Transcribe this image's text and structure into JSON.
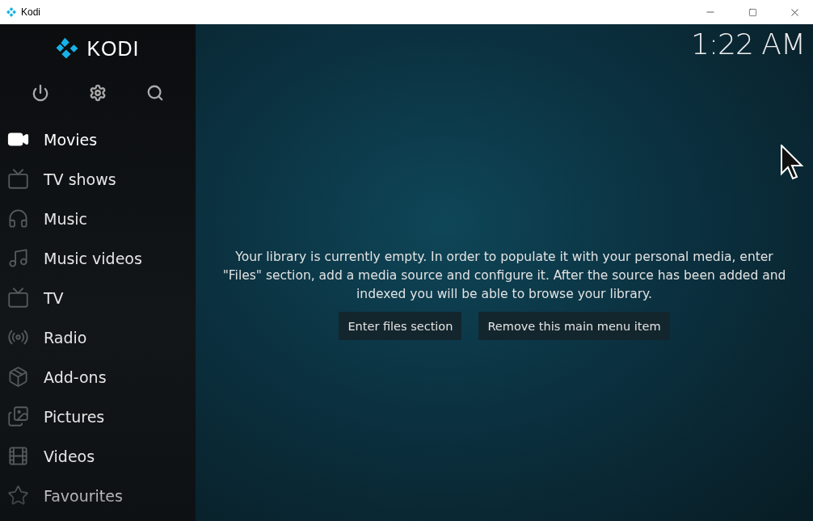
{
  "window": {
    "title": "Kodi"
  },
  "sidebar": {
    "logo": "KODI",
    "items": [
      {
        "label": "Movies",
        "selected": true
      },
      {
        "label": "TV shows",
        "selected": false
      },
      {
        "label": "Music",
        "selected": false
      },
      {
        "label": "Music videos",
        "selected": false
      },
      {
        "label": "TV",
        "selected": false
      },
      {
        "label": "Radio",
        "selected": false
      },
      {
        "label": "Add-ons",
        "selected": false
      },
      {
        "label": "Pictures",
        "selected": false
      },
      {
        "label": "Videos",
        "selected": false
      },
      {
        "label": "Favourites",
        "selected": false
      }
    ]
  },
  "clock": "1:22 AM",
  "message": "Your library is currently empty. In order to populate it with your personal media, enter \"Files\" section, add a media source and configure it. After the source has been added and indexed you will be able to browse your library.",
  "buttons": [
    "Enter files section",
    "Remove this main menu item"
  ]
}
